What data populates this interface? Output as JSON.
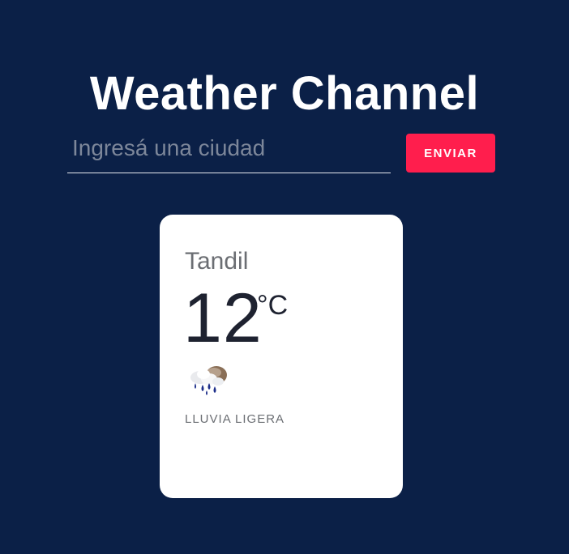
{
  "app": {
    "title": "Weather Channel"
  },
  "search": {
    "placeholder": "Ingresá una ciudad",
    "value": "",
    "button_label": "ENVIAR"
  },
  "weather_card": {
    "city": "Tandil",
    "temperature": "12",
    "unit": "°C",
    "icon": "light-rain-icon",
    "description": "LLUVIA LIGERA"
  },
  "colors": {
    "background": "#0b2047",
    "accent": "#ff1e4d",
    "card": "#ffffff"
  }
}
